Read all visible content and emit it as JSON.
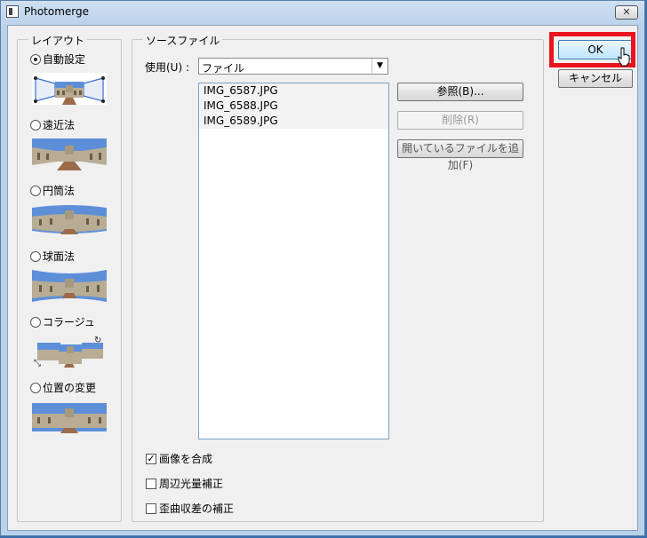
{
  "window": {
    "title": "Photomerge",
    "close_label": "✕"
  },
  "layout_group": {
    "title": "レイアウト",
    "options": [
      {
        "label": "自動設定",
        "checked": true
      },
      {
        "label": "遠近法",
        "checked": false
      },
      {
        "label": "円筒法",
        "checked": false
      },
      {
        "label": "球面法",
        "checked": false
      },
      {
        "label": "コラージュ",
        "checked": false
      },
      {
        "label": "位置の変更",
        "checked": false
      }
    ]
  },
  "source_group": {
    "title": "ソースファイル",
    "use_label": "使用(U) :",
    "use_value": "ファイル",
    "files": [
      "IMG_6587.JPG",
      "IMG_6588.JPG",
      "IMG_6589.JPG"
    ],
    "browse_label": "参照(B)...",
    "remove_label": "削除(R)",
    "add_open_label": "開いているファイルを追加(F)"
  },
  "options": {
    "blend_label": "画像を合成",
    "blend_checked": true,
    "vignette_label": "周辺光量補正",
    "vignette_checked": false,
    "distortion_label": "歪曲収差の補正",
    "distortion_checked": false
  },
  "dialog_buttons": {
    "ok_label": "OK",
    "cancel_label": "キャンセル"
  },
  "colors": {
    "highlight": "#e8141e",
    "sky": "#5d8fd8",
    "building": "#b8ad94"
  }
}
